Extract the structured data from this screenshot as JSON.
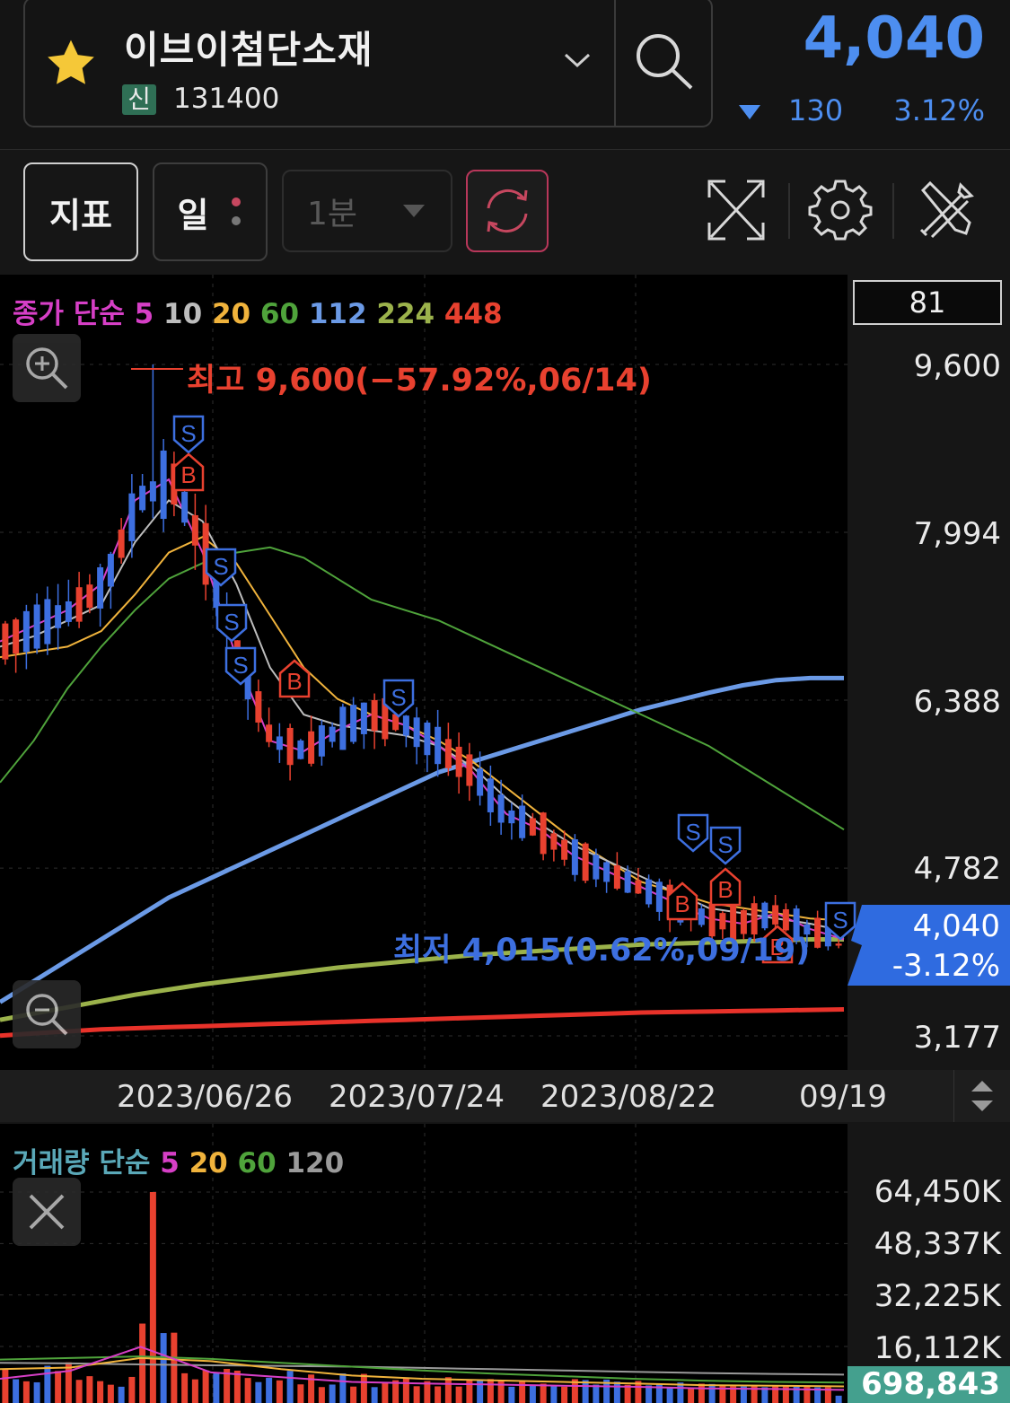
{
  "header": {
    "stock_name": "이브이첨단소재",
    "market_badge": "신",
    "stock_code": "131400",
    "price": "4,040",
    "change_abs": "130",
    "change_pct": "3.12%",
    "change_direction": "down",
    "icons": [
      "star-icon",
      "chevron-down-icon",
      "search-icon"
    ]
  },
  "toolbar": {
    "indicator_label": "지표",
    "period_label": "일",
    "interval_label": "1분",
    "icons": [
      "more-dots-icon",
      "dropdown-caret-icon",
      "refresh-icon",
      "expand-icon",
      "gear-icon",
      "tools-icon"
    ]
  },
  "colors": {
    "up": "#e8412f",
    "down": "#3d6fe0",
    "ma5": "#d63fc6",
    "ma10": "#bdbdbd",
    "ma20": "#f0b33c",
    "ma60": "#4fa33b",
    "ma112": "#6b9ae6",
    "ma224": "#9bb24b",
    "ma448": "#e8322a",
    "price_blue": "#4d8ef0"
  },
  "price_panel": {
    "legend": {
      "prefix": "종가 단순",
      "periods": [
        "5",
        "10",
        "20",
        "60",
        "112",
        "224",
        "448"
      ]
    },
    "count_box": "81",
    "y_labels": [
      "9,600",
      "7,994",
      "6,388",
      "4,782",
      "3,177"
    ],
    "current_price_tag": "4,040",
    "current_pct_tag": "-3.12%",
    "high_annotation": "최고 9,600(−57.92%,06/14)",
    "low_annotation": "최저 4,015(0.62%,09/19)",
    "signal_b": "B",
    "signal_s": "S"
  },
  "date_axis": {
    "labels": [
      "2023/06/26",
      "2023/07/24",
      "2023/08/22",
      "09/19"
    ]
  },
  "volume_panel": {
    "legend": {
      "prefix": "거래량 단순",
      "periods": [
        "5",
        "20",
        "60",
        "120"
      ]
    },
    "y_labels": [
      "64,450K",
      "48,337K",
      "32,225K",
      "16,112K"
    ],
    "current_volume_tag": "698,843"
  },
  "chart_data": {
    "type": "candlestick",
    "y_ticks": [
      9600,
      7994,
      6388,
      4782,
      3177
    ],
    "ylim": [
      2950,
      10200
    ],
    "high": 9600,
    "low": 4015,
    "last": 4040,
    "moving_averages": {
      "ma5": [
        6950,
        7100,
        7250,
        7500,
        8300,
        8500,
        7800,
        6800,
        6000,
        5900,
        6100,
        6250,
        6150,
        5950,
        5700,
        5300,
        5150,
        4900,
        4750,
        4600,
        4450,
        4300,
        4250,
        4350,
        4200,
        4100
      ],
      "ma10": [
        6900,
        7000,
        7150,
        7300,
        7900,
        8300,
        8100,
        7500,
        6700,
        6250,
        6150,
        6100,
        6050,
        5950,
        5750,
        5450,
        5200,
        5000,
        4850,
        4700,
        4550,
        4400,
        4350,
        4300,
        4250,
        4180
      ],
      "ma20": [
        6800,
        6850,
        6900,
        7050,
        7400,
        7800,
        7950,
        7700,
        7200,
        6700,
        6400,
        6250,
        6150,
        6000,
        5800,
        5550,
        5300,
        5050,
        4850,
        4650,
        4550,
        4450,
        4400,
        4350,
        4300,
        4280
      ],
      "ma60": [
        5600,
        6000,
        6500,
        6900,
        7250,
        7550,
        7700,
        7800,
        7850,
        7750,
        7550,
        7350,
        7250,
        7150,
        7000,
        6850,
        6700,
        6550,
        6400,
        6250,
        6100,
        5950,
        5750,
        5550,
        5350,
        5150
      ],
      "ma112": [
        3500,
        3700,
        3900,
        4100,
        4300,
        4500,
        4650,
        4800,
        4950,
        5100,
        5250,
        5400,
        5550,
        5700,
        5800,
        5900,
        6000,
        6100,
        6200,
        6300,
        6380,
        6460,
        6530,
        6580,
        6600,
        6600
      ],
      "ma224": [
        3330,
        3390,
        3450,
        3510,
        3570,
        3620,
        3670,
        3710,
        3750,
        3790,
        3830,
        3860,
        3890,
        3920,
        3950,
        3970,
        3990,
        4010,
        4030,
        4050,
        4060,
        4070,
        4080,
        4090,
        4100,
        4100
      ],
      "ma448": [
        3180,
        3200,
        3220,
        3240,
        3250,
        3260,
        3270,
        3280,
        3290,
        3300,
        3310,
        3320,
        3330,
        3340,
        3350,
        3360,
        3370,
        3380,
        3390,
        3400,
        3405,
        3410,
        3415,
        3420,
        3425,
        3430
      ]
    },
    "volume": {
      "ylim": [
        0,
        70000
      ],
      "y_ticks": [
        64450,
        48337,
        32225,
        16112
      ],
      "spike": 64450,
      "last": 698.843
    }
  }
}
